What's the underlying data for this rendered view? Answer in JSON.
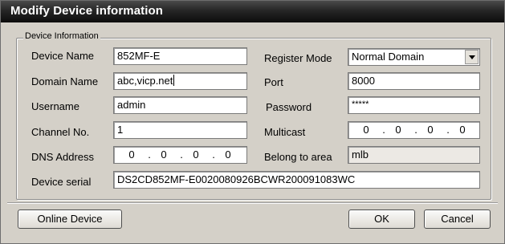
{
  "window": {
    "title": "Modify Device information"
  },
  "group": {
    "label": "Device Information"
  },
  "fields": {
    "device_name": {
      "label": "Device Name",
      "value": "852MF-E"
    },
    "domain_name": {
      "label": "Domain Name",
      "value": "abc,vicp.net"
    },
    "username": {
      "label": "Username",
      "value": "admin"
    },
    "channel_no": {
      "label": "Channel No.",
      "value": "1"
    },
    "dns_address": {
      "label": "DNS Address",
      "octets": [
        "0",
        "0",
        "0",
        "0"
      ]
    },
    "device_serial": {
      "label": "Device serial",
      "value": "DS2CD852MF-E0020080926BCWR200091083WC"
    },
    "register_mode": {
      "label": "Register Mode",
      "value": "Normal Domain"
    },
    "port": {
      "label": "Port",
      "value": "8000"
    },
    "password": {
      "label": "Password",
      "value": "*****"
    },
    "multicast": {
      "label": "Multicast",
      "octets": [
        "0",
        "0",
        "0",
        "0"
      ]
    },
    "belong_to_area": {
      "label": "Belong to area",
      "value": "mlb"
    }
  },
  "buttons": {
    "online_device": "Online Device",
    "ok": "OK",
    "cancel": "Cancel"
  }
}
